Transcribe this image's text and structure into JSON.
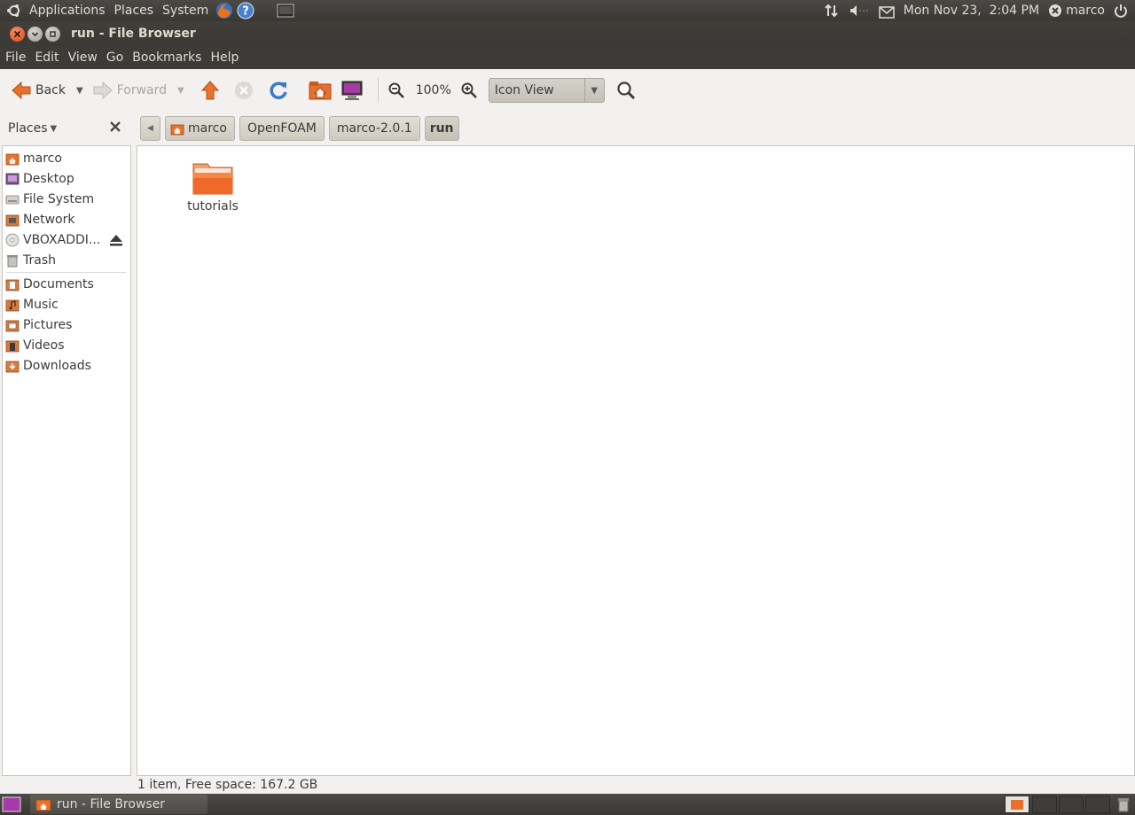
{
  "top_panel": {
    "menus": [
      "Applications",
      "Places",
      "System"
    ],
    "datetime": "Mon Nov 23,  2:04 PM",
    "user": "marco"
  },
  "window": {
    "title": "run - File Browser"
  },
  "menubar": [
    "File",
    "Edit",
    "View",
    "Go",
    "Bookmarks",
    "Help"
  ],
  "toolbar": {
    "back_label": "Back",
    "forward_label": "Forward",
    "zoom_level": "100%",
    "view_mode": "Icon View"
  },
  "places": {
    "header": "Places",
    "items": [
      {
        "label": "marco",
        "icon": "home-folder-icon"
      },
      {
        "label": "Desktop",
        "icon": "desktop-icon"
      },
      {
        "label": "File System",
        "icon": "harddisk-icon"
      },
      {
        "label": "Network",
        "icon": "network-icon"
      },
      {
        "label": "VBOXADDI...",
        "icon": "cdrom-icon"
      },
      {
        "label": "Trash",
        "icon": "trash-icon"
      }
    ],
    "bookmarks": [
      {
        "label": "Documents",
        "icon": "documents-folder-icon"
      },
      {
        "label": "Music",
        "icon": "music-folder-icon"
      },
      {
        "label": "Pictures",
        "icon": "pictures-folder-icon"
      },
      {
        "label": "Videos",
        "icon": "videos-folder-icon"
      },
      {
        "label": "Downloads",
        "icon": "downloads-folder-icon"
      }
    ]
  },
  "pathbar": [
    "marco",
    "OpenFOAM",
    "marco-2.0.1",
    "run"
  ],
  "files": [
    {
      "name": "tutorials",
      "icon": "folder-icon"
    }
  ],
  "status": "1 item, Free space: 167.2 GB",
  "taskbar": {
    "task_label": "run - File Browser"
  },
  "colors": {
    "accent": "#dd4814",
    "panel": "#3c3b37",
    "window_bg": "#f2f1f0"
  }
}
